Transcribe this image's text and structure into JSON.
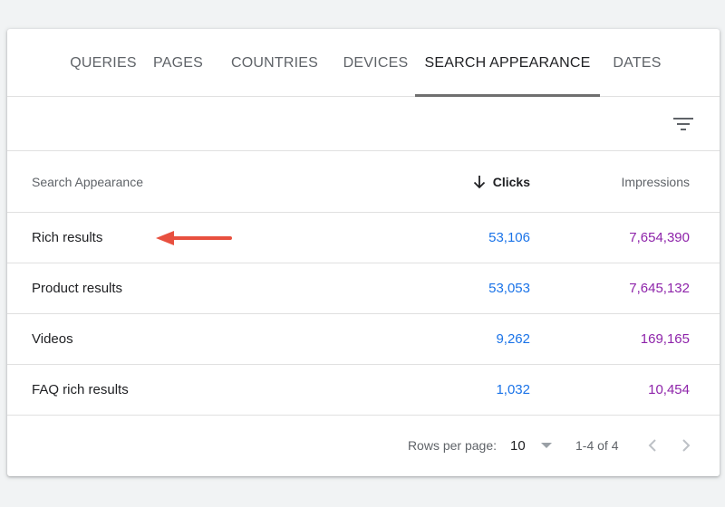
{
  "tabs": [
    {
      "label": "QUERIES",
      "active": false
    },
    {
      "label": "PAGES",
      "active": false
    },
    {
      "label": "COUNTRIES",
      "active": false
    },
    {
      "label": "DEVICES",
      "active": false
    },
    {
      "label": "SEARCH APPEARANCE",
      "active": true
    },
    {
      "label": "DATES",
      "active": false
    }
  ],
  "filter": {
    "icon": "filter-list-icon"
  },
  "table": {
    "headers": {
      "name": "Search Appearance",
      "clicks": "Clicks",
      "clicks_sort_icon": "arrow-down-icon",
      "impressions": "Impressions"
    },
    "rows": [
      {
        "name": "Rich results",
        "clicks": "53,106",
        "impressions": "7,654,390"
      },
      {
        "name": "Product results",
        "clicks": "53,053",
        "impressions": "7,645,132"
      },
      {
        "name": "Videos",
        "clicks": "9,262",
        "impressions": "169,165"
      },
      {
        "name": "FAQ rich results",
        "clicks": "1,032",
        "impressions": "10,454"
      }
    ]
  },
  "annotation": {
    "icon": "red-arrow-icon",
    "color": "#e8503f"
  },
  "pagination": {
    "rows_per_page_label": "Rows per page:",
    "rows_per_page_value": "10",
    "range": "1-4 of 4"
  },
  "colors": {
    "clicks": "#1a73e8",
    "impressions": "#8e24aa",
    "active_tab_indicator": "#6f6f6f"
  }
}
